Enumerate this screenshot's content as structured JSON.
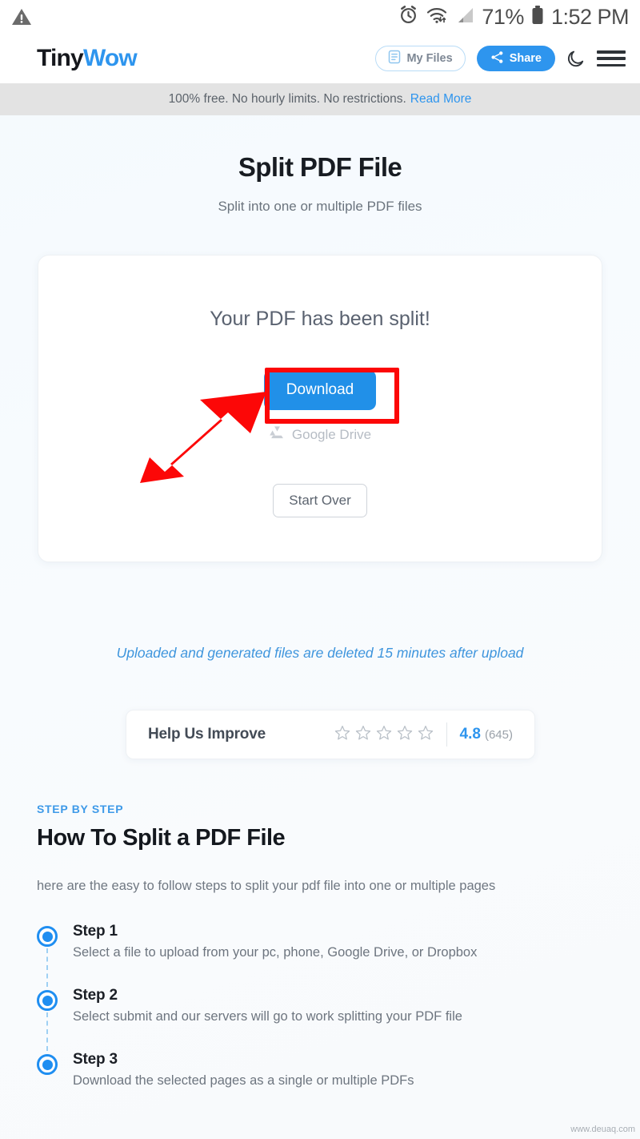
{
  "statusbar": {
    "warning_icon": "warning-triangle-icon",
    "alarm_icon": "alarm-clock-icon",
    "wifi_icon": "wifi-icon",
    "signal_icon": "cellular-signal-icon",
    "battery_percent": "71%",
    "battery_icon": "battery-icon",
    "time": "1:52 PM"
  },
  "header": {
    "logo_part1": "Tiny",
    "logo_part2": "Wow",
    "my_files_label": "My Files",
    "my_files_icon": "document-icon",
    "share_label": "Share",
    "share_icon": "share-nodes-icon",
    "dark_mode_icon": "moon-icon",
    "menu_icon": "hamburger-menu-icon"
  },
  "notice": {
    "text": "100% free. No hourly limits. No restrictions.",
    "link_label": "Read More"
  },
  "page": {
    "title": "Split PDF File",
    "subtitle": "Split into one or multiple PDF files"
  },
  "result_card": {
    "heading": "Your PDF has been split!",
    "download_label": "Download",
    "google_drive_label": "Google Drive",
    "google_drive_icon": "google-drive-icon",
    "start_over_label": "Start Over"
  },
  "annotations": {
    "highlight_color": "#fc0707",
    "arrow_color": "#fc0707",
    "target": "Download"
  },
  "delete_note": "Uploaded and generated files are deleted 15 minutes after upload",
  "rating": {
    "label": "Help Us Improve",
    "stars_total": 5,
    "stars_filled": 0,
    "score": "4.8",
    "count": "(645)",
    "score_color": "#2e95ee"
  },
  "steps_section": {
    "kicker": "STEP BY STEP",
    "title": "How To Split a PDF File",
    "intro": "here are the easy to follow steps to split your pdf file into one or multiple pages",
    "steps": [
      {
        "title": "Step 1",
        "desc": "Select a file to upload from your pc, phone, Google Drive, or Dropbox"
      },
      {
        "title": "Step 2",
        "desc": "Select submit and our servers will go to work splitting your PDF file"
      },
      {
        "title": "Step 3",
        "desc": "Download the selected pages as a single or multiple PDFs"
      }
    ]
  },
  "watermark": "www.deuaq.com"
}
